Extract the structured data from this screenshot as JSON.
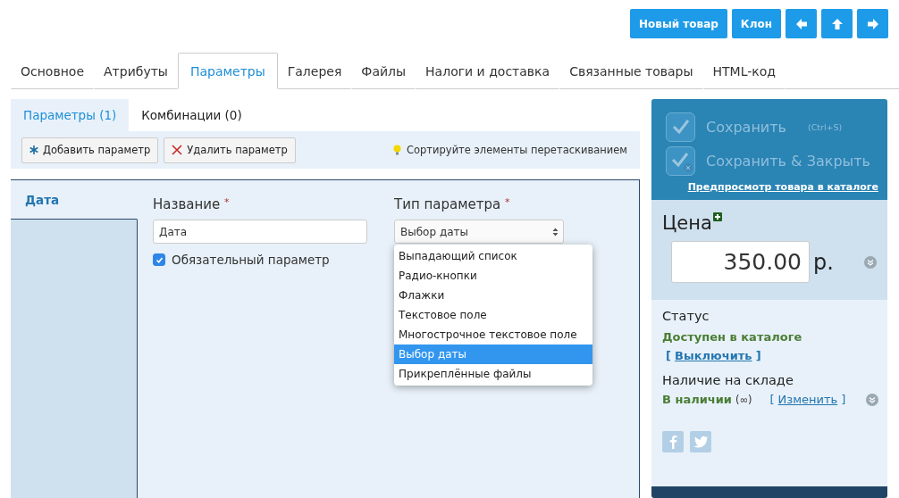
{
  "top_buttons": [
    {
      "kind": "text",
      "label": "Новый товар"
    },
    {
      "kind": "text",
      "label": "Клон"
    },
    {
      "kind": "left"
    },
    {
      "kind": "up"
    },
    {
      "kind": "right"
    }
  ],
  "tabs": [
    {
      "label": "Основное",
      "selected": false
    },
    {
      "label": "Атрибуты",
      "selected": false
    },
    {
      "label": "Параметры",
      "selected": true
    },
    {
      "label": "Галерея",
      "selected": false
    },
    {
      "label": "Файлы",
      "selected": false
    },
    {
      "label": "Налоги и доставка",
      "selected": false
    },
    {
      "label": "Связанные товары",
      "selected": false
    },
    {
      "label": "HTML-код",
      "selected": false
    }
  ],
  "subtabs": [
    {
      "label": "Параметры (1)",
      "selected": true
    },
    {
      "label": "Комбинации (0)",
      "selected": false
    }
  ],
  "toolbar": {
    "buttons": [
      {
        "kind": "add",
        "label": "Добавить параметр"
      },
      {
        "kind": "delete",
        "label": "Удалить параметр"
      }
    ],
    "hint": "Сортируйте элементы перетаскиванием"
  },
  "parameters": [
    {
      "label": "Дата",
      "selected": true
    }
  ],
  "form": {
    "name": {
      "label": "Название",
      "required_mark": "*",
      "value": "Дата"
    },
    "type": {
      "label": "Тип параметра",
      "required_mark": "*",
      "value": "Выбор даты",
      "expanded": true,
      "options": [
        {
          "label": "Выпадающий список",
          "selected": false
        },
        {
          "label": "Радио-кнопки",
          "selected": false
        },
        {
          "label": "Флажки",
          "selected": false
        },
        {
          "label": "Текстовое поле",
          "selected": false
        },
        {
          "label": "Многострочное текстовое поле",
          "selected": false
        },
        {
          "label": "Выбор даты",
          "selected": true
        },
        {
          "label": "Прикреплённые файлы",
          "selected": false
        }
      ]
    },
    "required": {
      "label": "Обязательный параметр",
      "checked": true
    }
  },
  "sidebar": {
    "save": {
      "label": "Сохранить",
      "shortcut": "(Ctrl+S)"
    },
    "save_close": {
      "label": "Сохранить & Закрыть"
    },
    "preview_link": "Предпросмотр товара в каталоге",
    "price": {
      "label": "Цена",
      "value": "350.00",
      "currency": "р."
    },
    "status": {
      "label": "Статус",
      "value": "Доступен в каталоге",
      "bracket_open": "[",
      "action": "Выключить",
      "bracket_close": "]"
    },
    "stock": {
      "label": "Наличие на складе",
      "value": "В наличии",
      "extra": "(∞)",
      "bracket_open": "[",
      "action": "Изменить",
      "bracket_close": "]"
    }
  }
}
